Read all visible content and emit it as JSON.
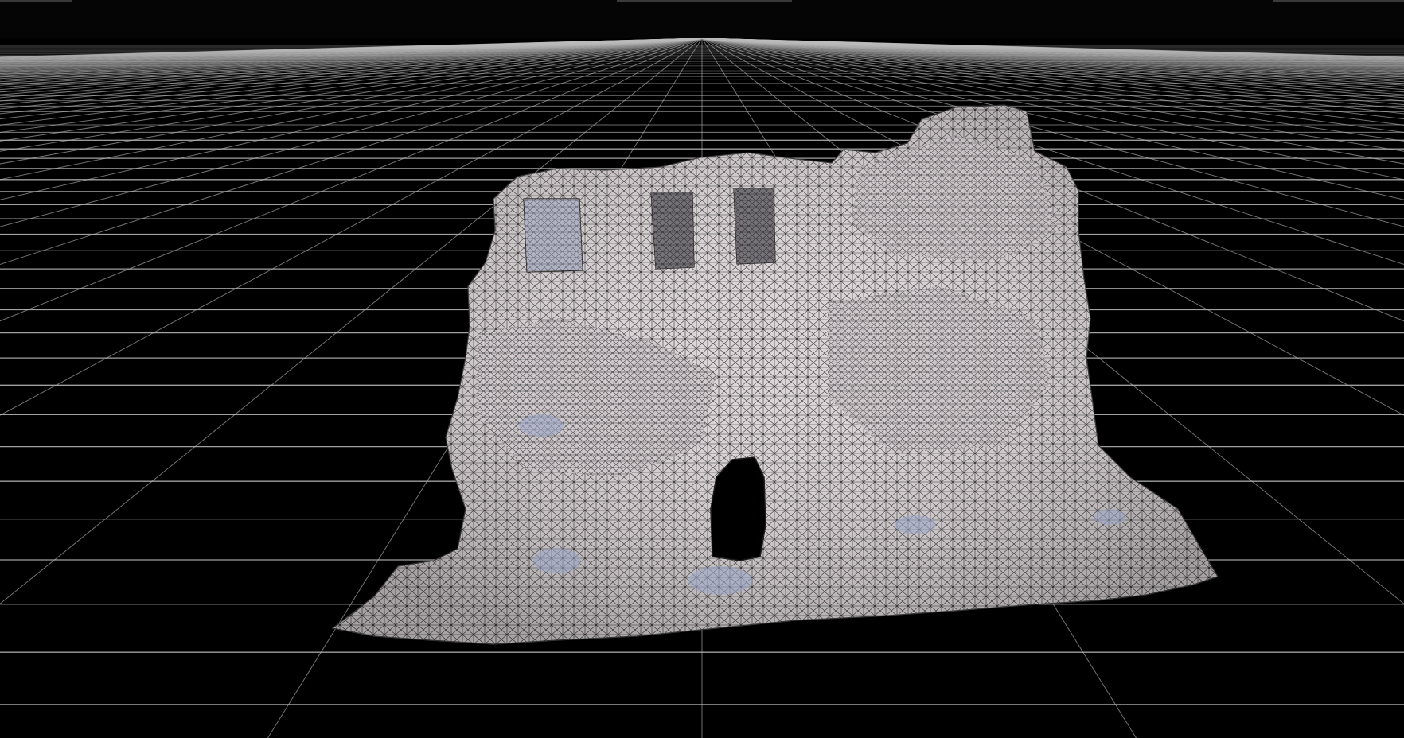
{
  "viewport": {
    "background": "#000000",
    "grid_color": "#bdbdbd",
    "mesh": {
      "fill": "#ddd6d8",
      "fill_shadow": "#a9acbf",
      "wire": "#2a2a2a",
      "accent_blue": "#9aa6c8"
    }
  }
}
